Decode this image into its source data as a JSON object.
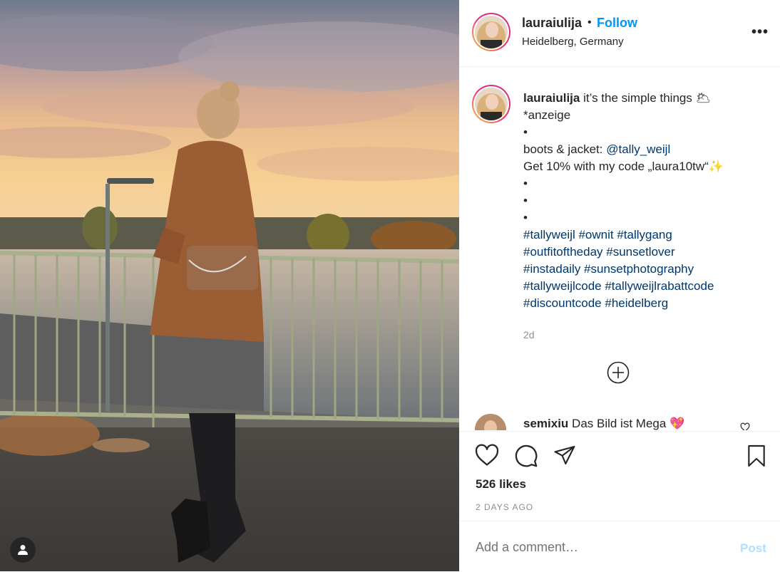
{
  "header": {
    "username": "lauraiulija",
    "separator": "•",
    "follow_label": "Follow",
    "location": "Heidelberg, Germany",
    "more_label": "•••"
  },
  "caption": {
    "username": "lauraiulija",
    "line1": " it’s the simple things 🌥",
    "line2": "*anzeige",
    "bullet1": "•",
    "line3_prefix": "boots & jacket: ",
    "mention": "@tally_weijl",
    "line4": "Get 10% with my code „laura10tw“✨",
    "bullet2": "•",
    "bullet3": "•",
    "bullet4": "•",
    "hashtags": [
      "#tallyweijl #ownit #tallygang",
      "#outfitoftheday #sunsetlover",
      "#instadaily #sunsetphotography",
      "#tallyweijlcode #tallyweijlrabattcode",
      "#discountcode #heidelberg"
    ],
    "time": "2d"
  },
  "comment": {
    "username": "semixiu",
    "text": " Das Bild ist Mega 💖"
  },
  "stats": {
    "likes": "526 likes",
    "ago": "2 DAYS AGO"
  },
  "add_comment": {
    "placeholder": "Add a comment…",
    "post_label": "Post"
  },
  "colors": {
    "link_blue": "#0095f6",
    "hashtag_blue": "#00376b",
    "post_disabled": "#b2dffc",
    "muted": "#8e8e8e"
  },
  "icons": [
    "heart-icon",
    "comment-icon",
    "share-icon",
    "bookmark-icon",
    "load-more-icon",
    "user-tag-icon",
    "more-options-icon"
  ]
}
